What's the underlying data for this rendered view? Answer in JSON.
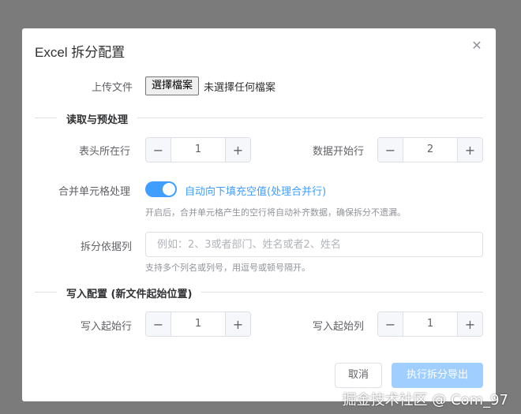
{
  "dialog": {
    "title": "Excel 拆分配置",
    "close_icon": "close-icon"
  },
  "upload": {
    "label": "上传文件",
    "choose_button": "選擇檔案",
    "no_file_text": "未選擇任何檔案"
  },
  "section_read": {
    "title": "读取与预处理"
  },
  "header_row": {
    "label": "表头所在行",
    "value": "1"
  },
  "data_start_row": {
    "label": "数据开始行",
    "value": "2"
  },
  "merge": {
    "label": "合并单元格处理",
    "switch_on": true,
    "switch_text": "自动向下填充空值(处理合并行)",
    "hint": "开启后，合并单元格产生的空行将自动补齐数据，确保拆分不遗漏。"
  },
  "split_column": {
    "label": "拆分依据列",
    "placeholder": "例如：2、3或者部门、姓名或者2、姓名",
    "value": "",
    "hint": "支持多个列名或列号，用逗号或顿号隔开。"
  },
  "section_write": {
    "title": "写入配置 (新文件起始位置)"
  },
  "write_start_row": {
    "label": "写入起始行",
    "value": "1"
  },
  "write_start_col": {
    "label": "写入起始列",
    "value": "1"
  },
  "stepper_symbols": {
    "minus": "−",
    "plus": "+"
  },
  "footer": {
    "cancel_label": "取消",
    "submit_label": "执行拆分导出"
  },
  "watermark": "掘金技术社区 @ Com_97",
  "colors": {
    "primary": "#409eff",
    "primary_disabled": "#a0cfff",
    "overlay": "#7b7b7b"
  }
}
